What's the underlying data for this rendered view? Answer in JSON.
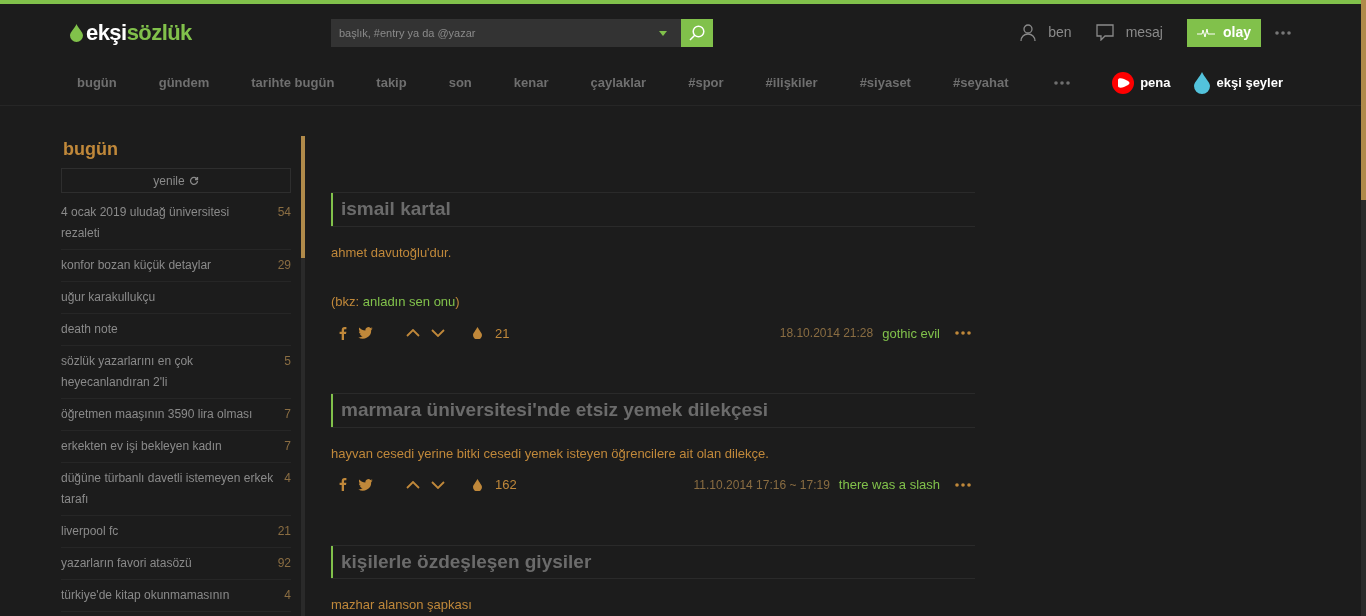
{
  "header": {
    "logo_first": "ekşi",
    "logo_second": "sözlük",
    "search": {
      "placeholder": "başlık, #entry ya da @yazar"
    },
    "user_links": [
      {
        "kind": "user",
        "label": "ben"
      },
      {
        "kind": "message",
        "label": "mesaj"
      }
    ],
    "event_button": "olay"
  },
  "nav": {
    "items": [
      {
        "label": "bugün",
        "selected": false
      },
      {
        "label": "gündem",
        "selected": false
      },
      {
        "label": "tarihte bugün",
        "selected": false
      },
      {
        "label": "takip",
        "selected": false
      },
      {
        "label": "son",
        "selected": false
      },
      {
        "label": "kenar",
        "selected": false
      },
      {
        "label": "çaylaklar",
        "selected": false
      },
      {
        "label": "#spor",
        "selected": false
      },
      {
        "label": "#ilişkiler",
        "selected": false
      },
      {
        "label": "#siyaset",
        "selected": false
      },
      {
        "label": "#seyahat",
        "selected": false
      }
    ],
    "extras": [
      {
        "kind": "pena",
        "label": "pena"
      },
      {
        "kind": "seyler",
        "label": "ekşi şeyler"
      }
    ]
  },
  "sidebar": {
    "title": "bugün",
    "refresh": "yenile",
    "items": [
      {
        "title": "4 ocak 2019 uludağ üniversitesi rezaleti",
        "count": "54"
      },
      {
        "title": "konfor bozan küçük detaylar",
        "count": "29"
      },
      {
        "title": "uğur karakullukçu"
      },
      {
        "title": "death note"
      },
      {
        "title": "sözlük yazarlarını en çok heyecanlandıran 2'li",
        "count": "5"
      },
      {
        "title": "öğretmen maaşının 3590 lira olması",
        "count": "7"
      },
      {
        "title": "erkekten ev işi bekleyen kadın",
        "count": "7"
      },
      {
        "title": "düğüne türbanlı davetli istemeyen erkek tarafı",
        "count": "4"
      },
      {
        "title": "liverpool fc",
        "count": "21"
      },
      {
        "title": "yazarların favori atasözü",
        "count": "92"
      },
      {
        "title": "türkiye'de kitap okunmamasının",
        "count": "4"
      }
    ]
  },
  "entries": [
    {
      "title": "ismail kartal",
      "body": [
        {
          "kind": "text",
          "text": "ahmet davutoğlu'dur."
        },
        {
          "kind": "bkz",
          "prefix": "(bkz: ",
          "link": "anladın sen onu",
          "suffix": ")"
        }
      ],
      "favorites": "21",
      "date": "18.10.2014 21:28",
      "author": "gothic evil"
    },
    {
      "title": "marmara üniversitesi'nde etsiz yemek dilekçesi",
      "body": [
        {
          "kind": "text",
          "text": "hayvan cesedi yerine bitki cesedi yemek isteyen öğrencilere ait olan dilekçe."
        }
      ],
      "favorites": "162",
      "date": "11.10.2014 17:16 ~ 17:19",
      "author": "there was a slash"
    },
    {
      "title": "kişilerle özdeşleşen giysiler",
      "body": [
        {
          "kind": "text",
          "text": "mazhar alanson şapkası"
        }
      ]
    }
  ]
}
